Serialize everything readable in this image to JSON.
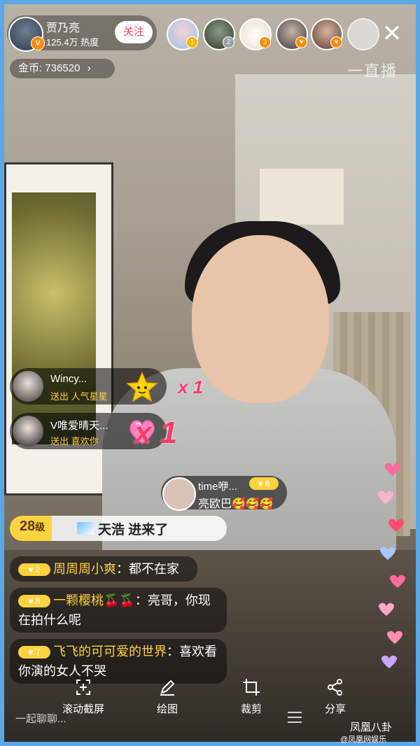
{
  "host": {
    "name": "贾乃亮",
    "heat": "125.4万 热度",
    "follow_label": "关注",
    "verified_badge": "V"
  },
  "viewers": [
    {
      "rank": "1",
      "badge_color": "#ffb400"
    },
    {
      "rank": "2",
      "badge_color": "#9aa0a6"
    },
    {
      "rank": "3",
      "badge_color": "#ff8a00"
    },
    {
      "rank": "",
      "badge_color": "#ff8a00"
    },
    {
      "rank": "",
      "badge_color": "#ff8a00"
    }
  ],
  "coins": {
    "label": "金币: 736520",
    "arrow": "›"
  },
  "watermark_top": "一直播",
  "gifts": [
    {
      "user": "Wincy...",
      "action": "送出 人气星星",
      "count": "x 1",
      "icon": "star-gift-icon"
    },
    {
      "user": "V唯爱晴天...",
      "action": "送出 喜欢你",
      "count": "x 1",
      "icon": "heart-gift-icon"
    }
  ],
  "time_message": {
    "user": "time咿...",
    "level": "6",
    "text": "亮欧巴🥰🥰🥰"
  },
  "join_banner": {
    "level": "28",
    "level_unit": "级",
    "text": "天浩 进来了"
  },
  "chat": [
    {
      "level": "2",
      "user": "周周周小爽",
      "text": "：都不在家"
    },
    {
      "level": "8",
      "user": "一颗樱桃🍒🍒",
      "text": "：亮哥，你现在拍什么呢"
    },
    {
      "level": "7",
      "user": "飞飞的可可爱的世界",
      "text": "：喜欢看你演的女人不哭"
    }
  ],
  "toolbar": [
    {
      "label": "滚动截屏",
      "icon": "scroll-capture-icon"
    },
    {
      "label": "绘图",
      "icon": "pencil-icon"
    },
    {
      "label": "裁剪",
      "icon": "crop-icon"
    },
    {
      "label": "分享",
      "icon": "share-icon"
    }
  ],
  "chat_placeholder": "一起聊聊...",
  "watermark_bottom": "凤凰八卦",
  "watermark_bottom2": "@凤凰网娱乐",
  "colors": {
    "accent": "#ffd23f",
    "follow": "#ff3d5a",
    "gift_count": "#ff3b6b"
  }
}
